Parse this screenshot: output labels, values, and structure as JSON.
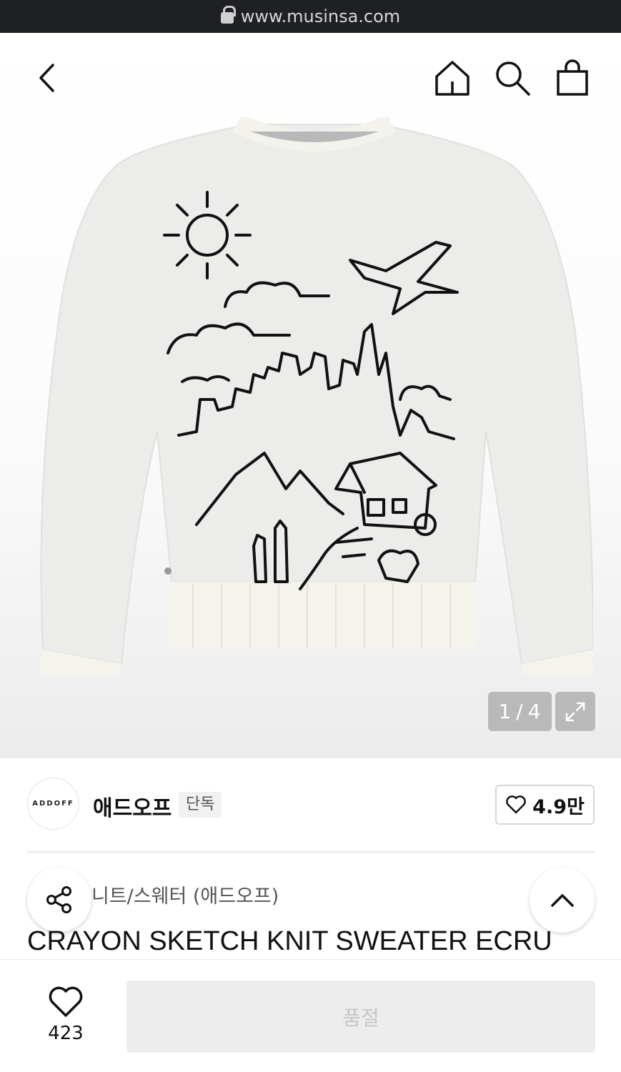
{
  "browser": {
    "url": "www.musinsa.com"
  },
  "header": {
    "back_icon": "chevron-left-icon",
    "home_icon": "home-icon",
    "search_icon": "search-icon",
    "cart_icon": "shopping-bag-icon"
  },
  "gallery": {
    "current": "1",
    "separator": "/",
    "total": "4",
    "expand_icon": "expand-icon"
  },
  "brand": {
    "logo_text": "ADDOFF",
    "name": "애드오프",
    "badge": "단독",
    "likes": "4.9만"
  },
  "product": {
    "category": "니트/스웨터 (애드오프)",
    "title": "CRAYON SKETCH KNIT SWEATER ECRU"
  },
  "bottom_bar": {
    "wish_count": "423",
    "buy_button_label": "품절"
  },
  "colors": {
    "url_bar": "#1f2023",
    "disabled_button": "#ededed",
    "counter_bg": "#b9b9b9"
  }
}
